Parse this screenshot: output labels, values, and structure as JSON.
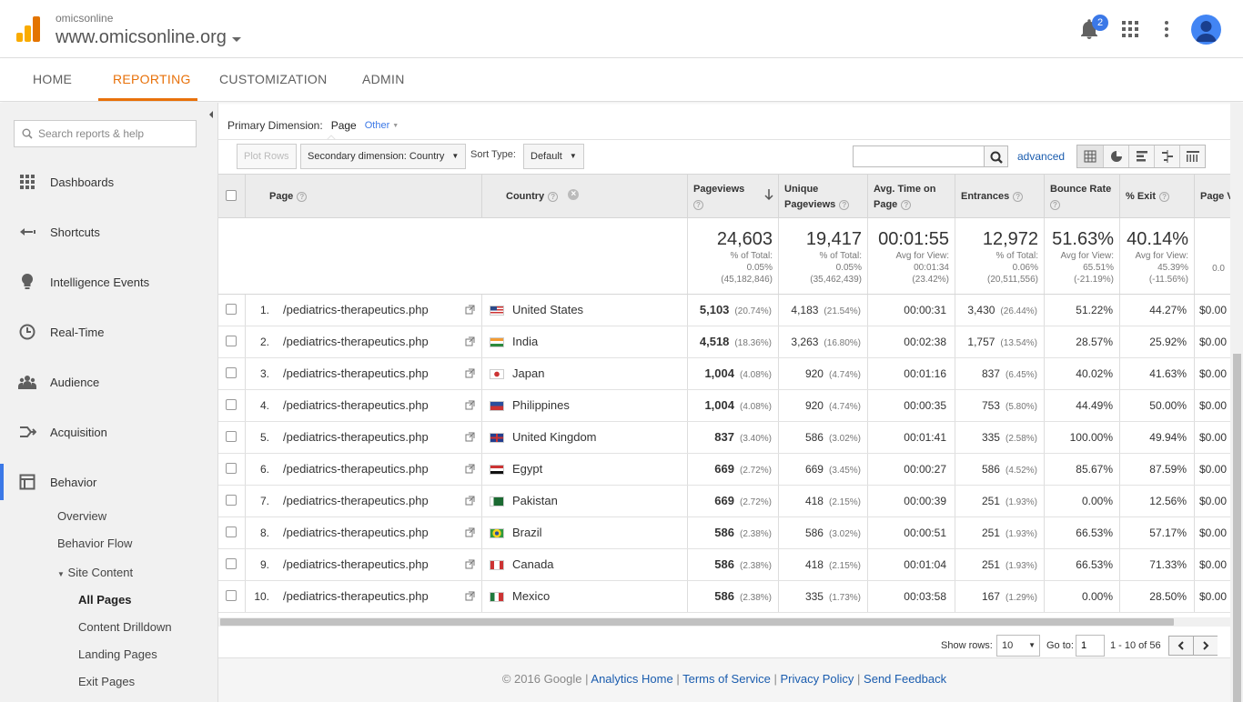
{
  "account": {
    "name": "omicsonline",
    "property": "www.omicsonline.org"
  },
  "notifications": {
    "count": "2"
  },
  "nav": {
    "tabs": [
      "HOME",
      "REPORTING",
      "CUSTOMIZATION",
      "ADMIN"
    ],
    "active": "REPORTING"
  },
  "sidebar": {
    "search_placeholder": "Search reports & help",
    "items": [
      "Dashboards",
      "Shortcuts",
      "Intelligence Events",
      "Real-Time",
      "Audience",
      "Acquisition",
      "Behavior"
    ],
    "selected": "Behavior",
    "sub": [
      "Overview",
      "Behavior Flow",
      "Site Content",
      "All Pages",
      "Content Drilldown",
      "Landing Pages",
      "Exit Pages"
    ]
  },
  "controls": {
    "primary_label": "Primary Dimension:",
    "primary_value": "Page",
    "other": "Other",
    "plot_rows": "Plot Rows",
    "secondary": "Secondary dimension: Country",
    "sort_label": "Sort Type:",
    "sort_value": "Default",
    "advanced": "advanced"
  },
  "table": {
    "headers": {
      "page": "Page",
      "country": "Country",
      "pageviews": "Pageviews",
      "unique1": "Unique",
      "unique2": "Pageviews",
      "avg1": "Avg. Time on",
      "avg2": "Page",
      "entrances": "Entrances",
      "bounce": "Bounce Rate",
      "exit": "% Exit",
      "pagevalue": "Page V"
    },
    "totals": {
      "pageviews": {
        "big": "24,603",
        "l1": "% of Total:",
        "l2": "0.05%",
        "l3": "(45,182,846)"
      },
      "unique": {
        "big": "19,417",
        "l1": "% of Total:",
        "l2": "0.05%",
        "l3": "(35,462,439)"
      },
      "avg": {
        "big": "00:01:55",
        "l1": "Avg for View:",
        "l2": "00:01:34",
        "l3": "(23.42%)"
      },
      "entrances": {
        "big": "12,972",
        "l1": "% of Total:",
        "l2": "0.06%",
        "l3": "(20,511,556)"
      },
      "bounce": {
        "big": "51.63%",
        "l1": "Avg for View:",
        "l2": "65.51%",
        "l3": "(-21.19%)"
      },
      "exit": {
        "big": "40.14%",
        "l1": "Avg for View:",
        "l2": "45.39%",
        "l3": "(-11.56%)"
      },
      "pagevalue": {
        "l2": "0.0"
      }
    },
    "rows": [
      {
        "n": "1.",
        "page": "/pediatrics-therapeutics.php",
        "country": "United States",
        "flag": "us",
        "pv": "5,103",
        "pvp": "(20.74%)",
        "upv": "4,183",
        "upvp": "(21.54%)",
        "avg": "00:00:31",
        "ent": "3,430",
        "entp": "(26.44%)",
        "bounce": "51.22%",
        "exit": "44.27%",
        "val": "$0.00"
      },
      {
        "n": "2.",
        "page": "/pediatrics-therapeutics.php",
        "country": "India",
        "flag": "in",
        "pv": "4,518",
        "pvp": "(18.36%)",
        "upv": "3,263",
        "upvp": "(16.80%)",
        "avg": "00:02:38",
        "ent": "1,757",
        "entp": "(13.54%)",
        "bounce": "28.57%",
        "exit": "25.92%",
        "val": "$0.00"
      },
      {
        "n": "3.",
        "page": "/pediatrics-therapeutics.php",
        "country": "Japan",
        "flag": "jp",
        "pv": "1,004",
        "pvp": "(4.08%)",
        "upv": "920",
        "upvp": "(4.74%)",
        "avg": "00:01:16",
        "ent": "837",
        "entp": "(6.45%)",
        "bounce": "40.02%",
        "exit": "41.63%",
        "val": "$0.00"
      },
      {
        "n": "4.",
        "page": "/pediatrics-therapeutics.php",
        "country": "Philippines",
        "flag": "ph",
        "pv": "1,004",
        "pvp": "(4.08%)",
        "upv": "920",
        "upvp": "(4.74%)",
        "avg": "00:00:35",
        "ent": "753",
        "entp": "(5.80%)",
        "bounce": "44.49%",
        "exit": "50.00%",
        "val": "$0.00"
      },
      {
        "n": "5.",
        "page": "/pediatrics-therapeutics.php",
        "country": "United Kingdom",
        "flag": "gb",
        "pv": "837",
        "pvp": "(3.40%)",
        "upv": "586",
        "upvp": "(3.02%)",
        "avg": "00:01:41",
        "ent": "335",
        "entp": "(2.58%)",
        "bounce": "100.00%",
        "exit": "49.94%",
        "val": "$0.00"
      },
      {
        "n": "6.",
        "page": "/pediatrics-therapeutics.php",
        "country": "Egypt",
        "flag": "eg",
        "pv": "669",
        "pvp": "(2.72%)",
        "upv": "669",
        "upvp": "(3.45%)",
        "avg": "00:00:27",
        "ent": "586",
        "entp": "(4.52%)",
        "bounce": "85.67%",
        "exit": "87.59%",
        "val": "$0.00"
      },
      {
        "n": "7.",
        "page": "/pediatrics-therapeutics.php",
        "country": "Pakistan",
        "flag": "pk",
        "pv": "669",
        "pvp": "(2.72%)",
        "upv": "418",
        "upvp": "(2.15%)",
        "avg": "00:00:39",
        "ent": "251",
        "entp": "(1.93%)",
        "bounce": "0.00%",
        "exit": "12.56%",
        "val": "$0.00"
      },
      {
        "n": "8.",
        "page": "/pediatrics-therapeutics.php",
        "country": "Brazil",
        "flag": "br",
        "pv": "586",
        "pvp": "(2.38%)",
        "upv": "586",
        "upvp": "(3.02%)",
        "avg": "00:00:51",
        "ent": "251",
        "entp": "(1.93%)",
        "bounce": "66.53%",
        "exit": "57.17%",
        "val": "$0.00"
      },
      {
        "n": "9.",
        "page": "/pediatrics-therapeutics.php",
        "country": "Canada",
        "flag": "ca",
        "pv": "586",
        "pvp": "(2.38%)",
        "upv": "418",
        "upvp": "(2.15%)",
        "avg": "00:01:04",
        "ent": "251",
        "entp": "(1.93%)",
        "bounce": "66.53%",
        "exit": "71.33%",
        "val": "$0.00"
      },
      {
        "n": "10.",
        "page": "/pediatrics-therapeutics.php",
        "country": "Mexico",
        "flag": "mx",
        "pv": "586",
        "pvp": "(2.38%)",
        "upv": "335",
        "upvp": "(1.73%)",
        "avg": "00:03:58",
        "ent": "167",
        "entp": "(1.29%)",
        "bounce": "0.00%",
        "exit": "28.50%",
        "val": "$0.00"
      }
    ]
  },
  "pager": {
    "show_rows_label": "Show rows:",
    "rows_value": "10",
    "goto_label": "Go to:",
    "goto_value": "1",
    "range": "1 - 10 of 56"
  },
  "footer": {
    "copyright": "© 2016 Google",
    "links": [
      "Analytics Home",
      "Terms of Service",
      "Privacy Policy",
      "Send Feedback"
    ]
  },
  "colors": {
    "accent": "#e8710a",
    "link": "#1a5cae",
    "selection": "#3b78e7"
  }
}
